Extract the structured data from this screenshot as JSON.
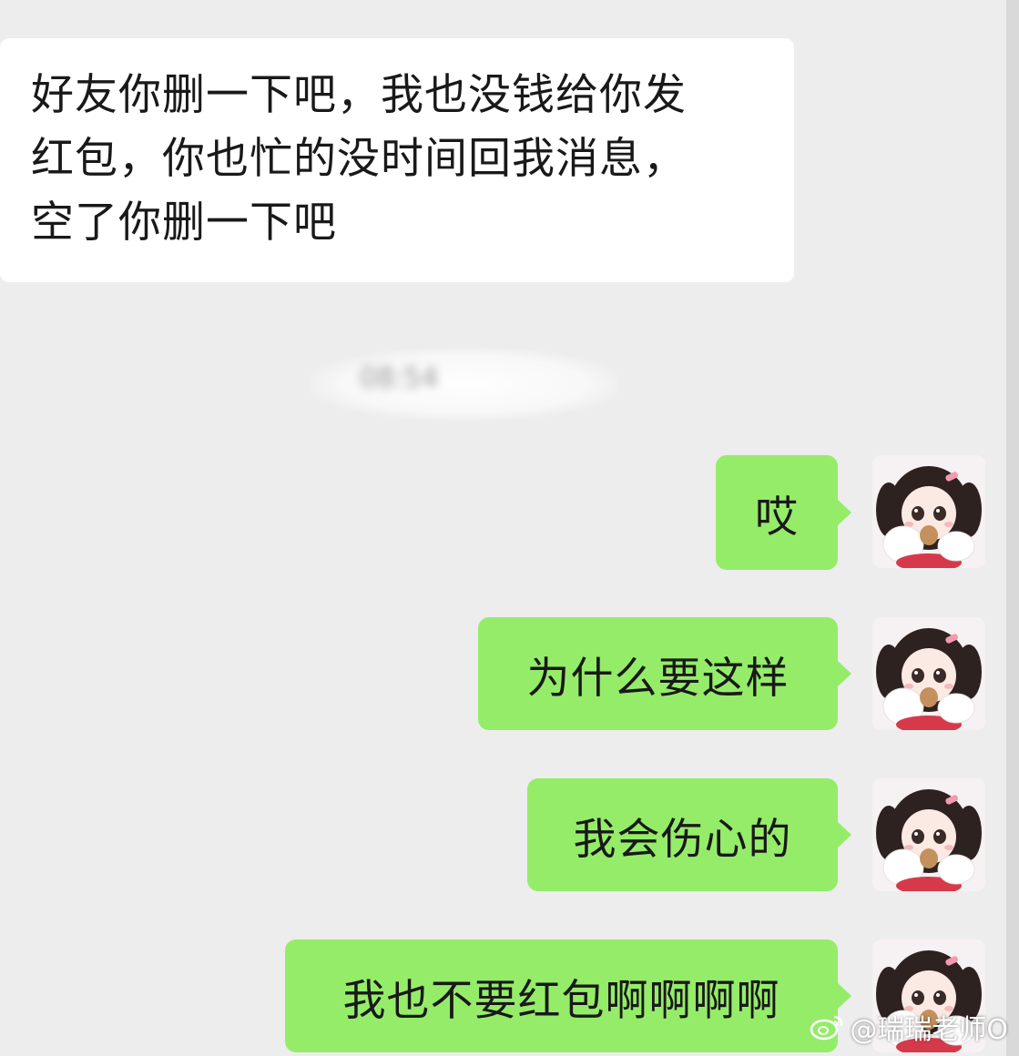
{
  "chat": {
    "incoming": {
      "line1": "好友你删一下吧，我也没钱给你发",
      "line2": "红包，你也忙的没时间回我消息，",
      "line3": "空了你删一下吧"
    },
    "timestamp": "08:54",
    "outgoing": [
      {
        "text": "哎"
      },
      {
        "text": "为什么要这样"
      },
      {
        "text": "我会伤心的"
      },
      {
        "text": "我也不要红包啊啊啊啊"
      }
    ]
  },
  "watermark": {
    "text": "@瑞瑞老师O",
    "icon": "weibo-icon"
  },
  "colors": {
    "background": "#ededed",
    "incoming_bubble": "#ffffff",
    "outgoing_bubble": "#95ec69",
    "text": "#191919"
  }
}
